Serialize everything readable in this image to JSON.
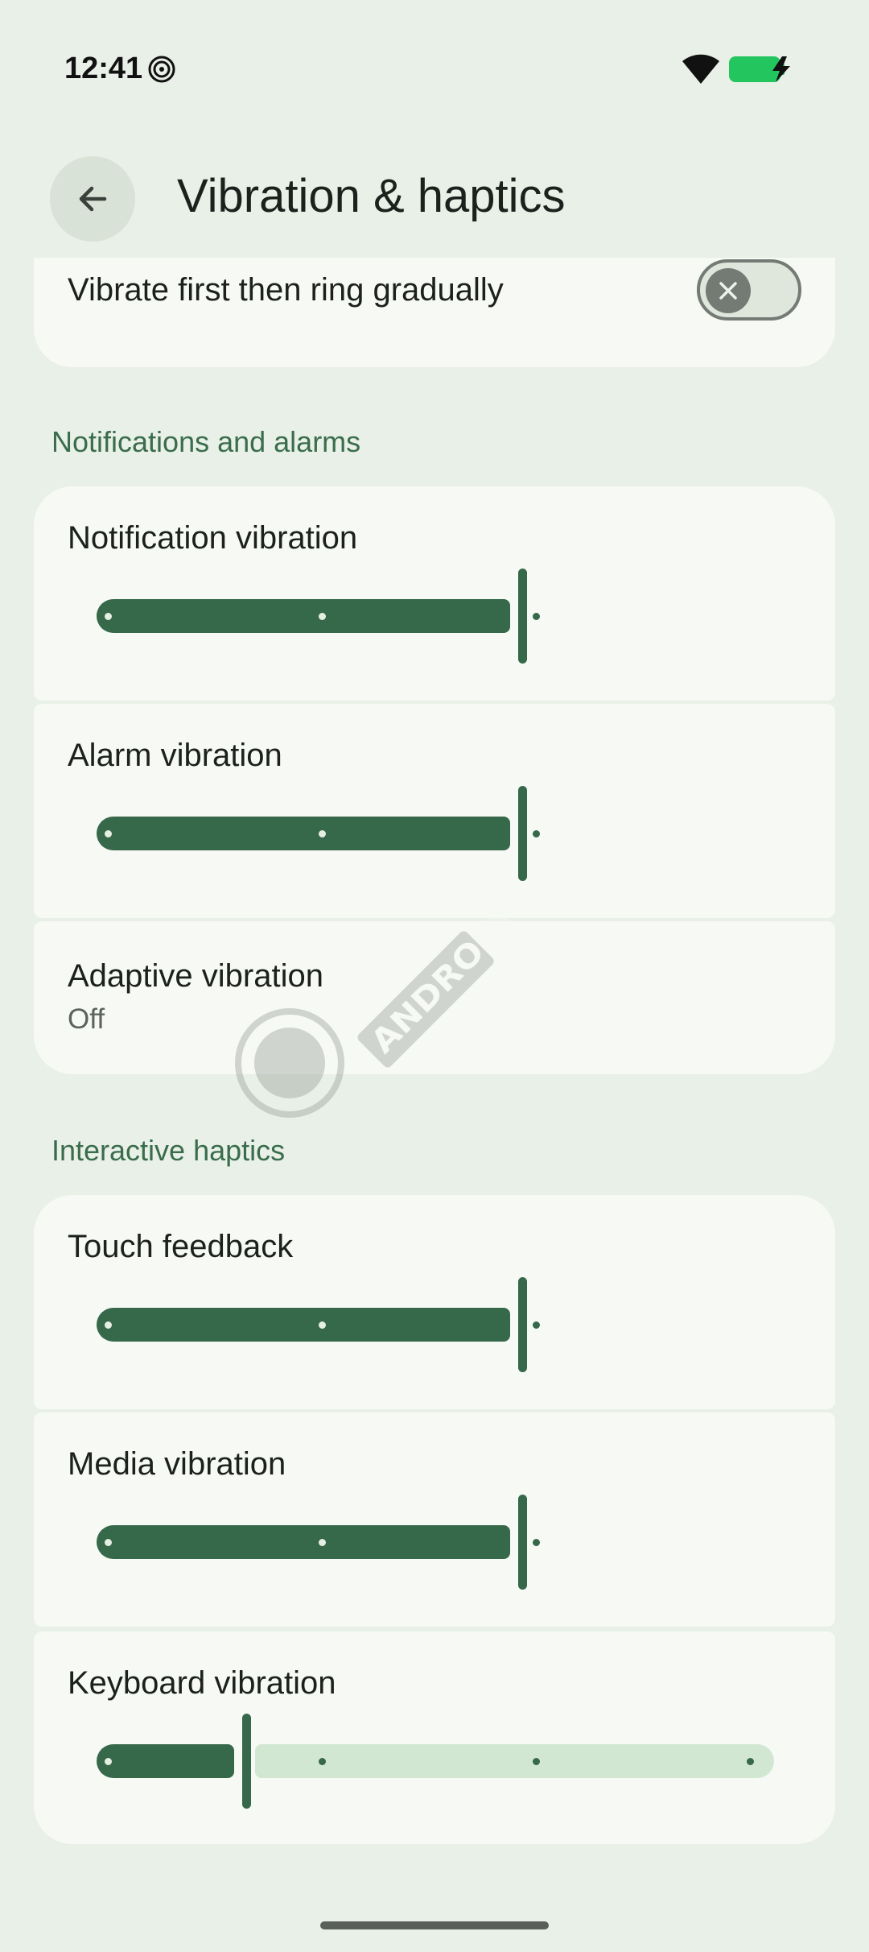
{
  "status_bar": {
    "time": "12:41",
    "battery_color": "#22c55e"
  },
  "header": {
    "title": "Vibration & haptics",
    "back_icon": "arrow-left-icon"
  },
  "top_card": {
    "label": "Vibrate first then ring gradually",
    "toggle_on": false
  },
  "sections": [
    {
      "title": "Notifications and alarms",
      "items": [
        {
          "label": "Notification vibration",
          "value": 1.0
        },
        {
          "label": "Alarm vibration",
          "value": 1.0
        },
        {
          "label": "Adaptive vibration",
          "subtitle": "Off"
        }
      ]
    },
    {
      "title": "Interactive haptics",
      "items": [
        {
          "label": "Touch feedback",
          "value": 1.0
        },
        {
          "label": "Media vibration",
          "value": 1.0
        },
        {
          "label": "Keyboard vibration",
          "value": 0.333
        }
      ]
    }
  ],
  "watermark": {
    "text": "ANDROID AUTHORITY"
  },
  "colors": {
    "accent": "#36684a",
    "inactive_track": "#d2e7d2",
    "background": "#e9f0e7",
    "card": "#f6f9f4"
  }
}
